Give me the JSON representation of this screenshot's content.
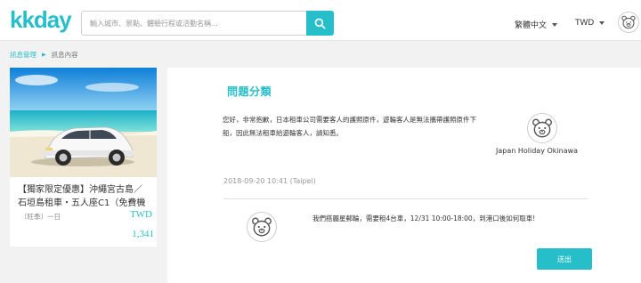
{
  "header": {
    "logo": "kkday",
    "search_placeholder": "輸入城市、景點、體驗行程或活動名稱...",
    "language": "繁體中文",
    "currency": "TWD"
  },
  "breadcrumb": {
    "parent": "訊息管理",
    "current": "訊息內容"
  },
  "product": {
    "title_line1": "【獨家限定優惠】沖繩宮古島／",
    "title_line2": "石垣島租車・五人座C1（免費機",
    "meta": "〔旺季〕一日",
    "currency": "TWD",
    "price": "1,341"
  },
  "conversation": {
    "section_title": "問題分類",
    "supplier_message": "您好，非常抱歉，日本租車公司需要客人的護照原件，遊輪客人是無法攜帶護照原件下船，因此無法租車給遊輪客人，請知悉。",
    "supplier_name": "Japan Holiday Okinawa",
    "timestamp": "2018-09-20 10:41 (Taipei)",
    "user_message": "我們搭麗星郵輪，需要租4台車，12/31 10:00-18:00，到港口後如何取車!",
    "send_label": "送出"
  },
  "colors": {
    "brand": "#26bec9"
  },
  "icons": [
    "search-icon",
    "chevron-down-icon",
    "bear-avatar-icon",
    "car-photo"
  ]
}
